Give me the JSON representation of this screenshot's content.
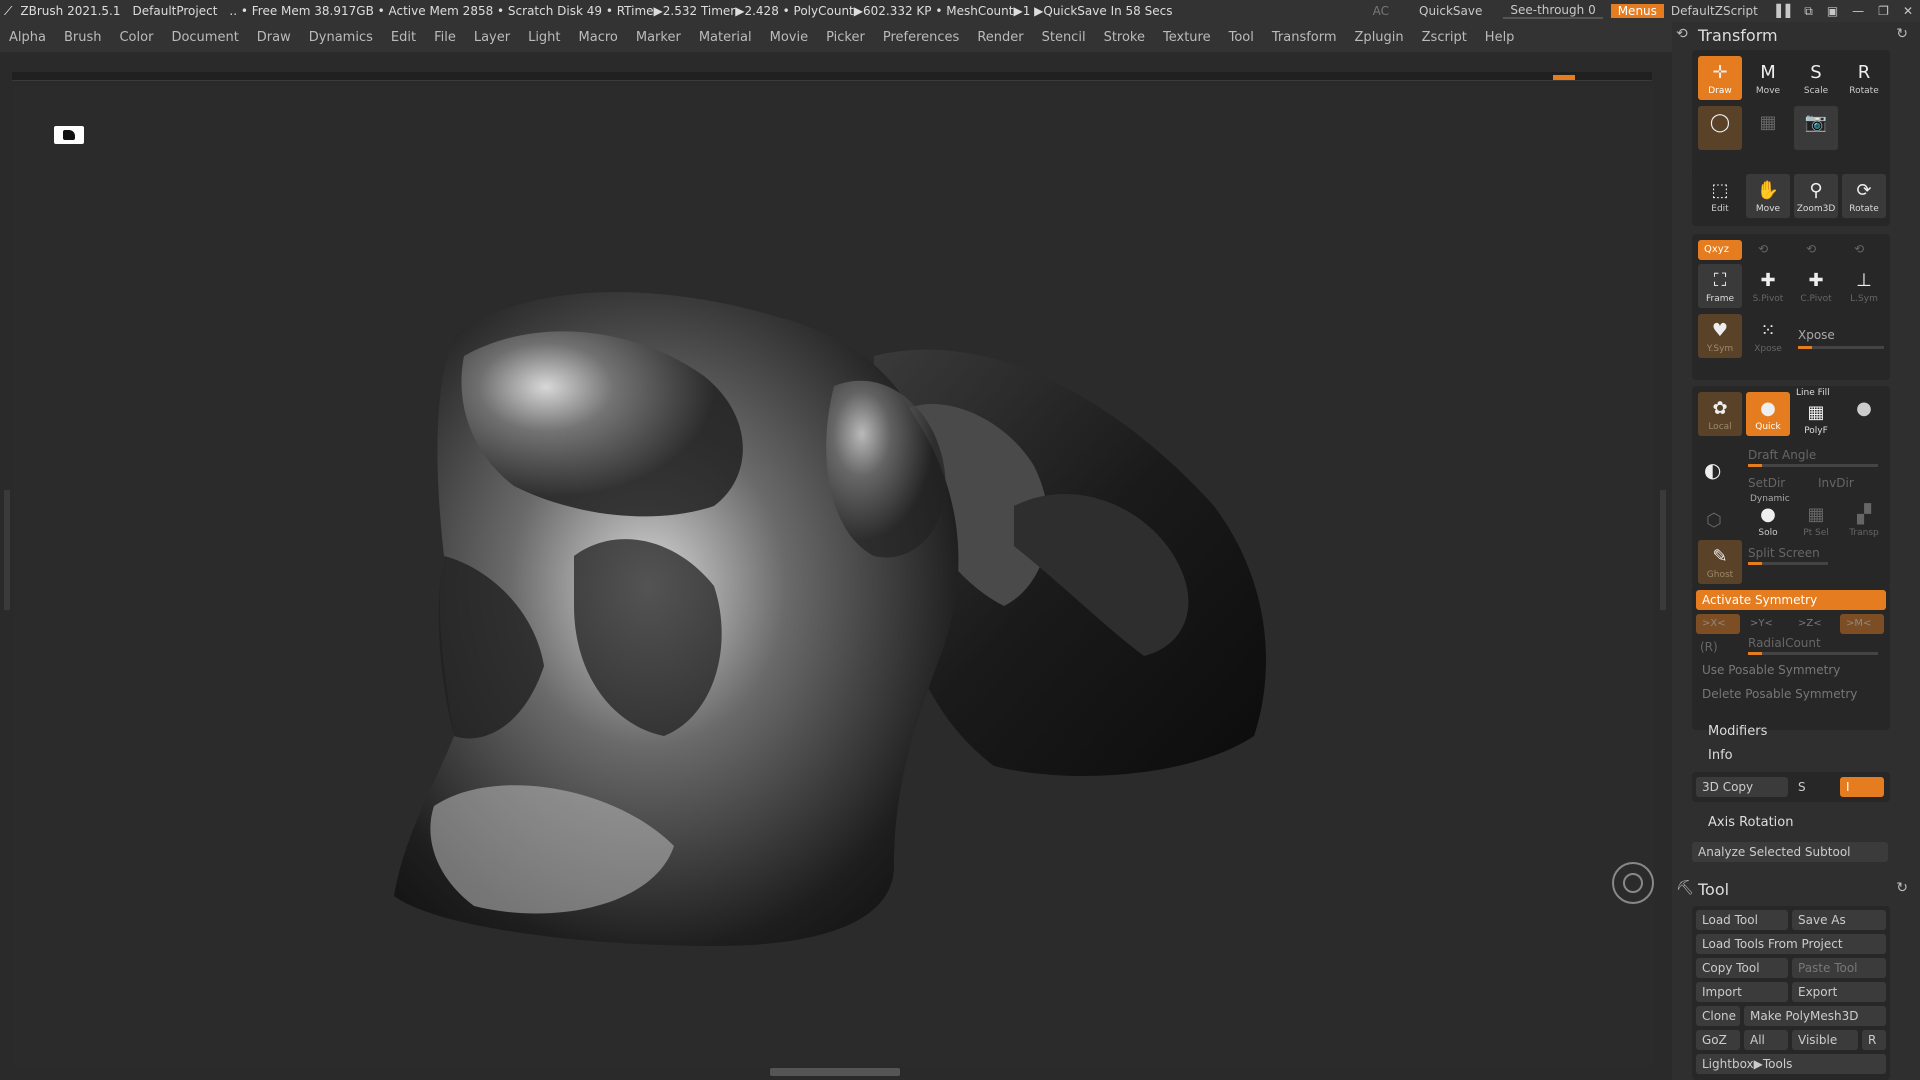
{
  "topbar": {
    "app": "ZBrush 2021.5.1",
    "project": "DefaultProject",
    "stats": ".. • Free Mem 38.917GB • Active Mem 2858 • Scratch Disk 49 •  RTime▶2.532 Timer▶2.428 • PolyCount▶602.332 KP  • MeshCount▶1  ▶QuickSave In 58 Secs",
    "ac": "AC",
    "quicksave": "QuickSave",
    "see_through": "See-through  0",
    "menus": "Menus",
    "script": "DefaultZScript"
  },
  "menus": [
    "Alpha",
    "Brush",
    "Color",
    "Document",
    "Draw",
    "Dynamics",
    "Edit",
    "File",
    "Layer",
    "Light",
    "Macro",
    "Marker",
    "Material",
    "Movie",
    "Picker",
    "Preferences",
    "Render",
    "Stencil",
    "Stroke",
    "Texture",
    "Tool",
    "Transform",
    "Zplugin",
    "Zscript",
    "Help"
  ],
  "transform": {
    "title": "Transform",
    "row1": [
      "Draw",
      "Move",
      "Scale",
      "Rotate"
    ],
    "row3": [
      "Edit",
      "Move",
      "Zoom3D",
      "Rotate"
    ],
    "xyz": "Qxyz",
    "frame": "Frame",
    "spivot": "S.Pivot",
    "cpivot": "C.Pivot",
    "lsym": "L.Sym",
    "ysym": "Y.Sym",
    "xpose_btn": "Xpose",
    "xpose": "Xpose",
    "local": "Local",
    "quick": "Quick",
    "line_fill": "Line Fill",
    "polyf": "PolyF",
    "draft_angle": "Draft Angle",
    "setdir": "SetDir",
    "invdir": "InvDir",
    "dynamic": "Dynamic",
    "solo": "Solo",
    "ptsel": "Pt Sel",
    "transp": "Transp",
    "ghost": "Ghost",
    "split_screen": "Split Screen",
    "activate_symmetry": "Activate Symmetry",
    "axes": [
      ">X<",
      ">Y<",
      ">Z<",
      ">M<"
    ],
    "r": "(R)",
    "radial_count": "RadialCount",
    "use_posable": "Use Posable Symmetry",
    "delete_posable": "Delete Posable Symmetry",
    "modifiers": "Modifiers",
    "info": "Info",
    "copy3d": "3D Copy",
    "s": "S",
    "i": "I",
    "axis_rotation": "Axis Rotation",
    "analyze": "Analyze Selected Subtool"
  },
  "tool": {
    "title": "Tool",
    "load_tool": "Load Tool",
    "save_as": "Save As",
    "load_from_project": "Load Tools From Project",
    "copy_tool": "Copy Tool",
    "paste_tool": "Paste Tool",
    "import": "Import",
    "export": "Export",
    "clone": "Clone",
    "make_polymesh": "Make PolyMesh3D",
    "goz": "GoZ",
    "all": "All",
    "visible": "Visible",
    "r": "R",
    "lightbox": "Lightbox▶Tools"
  }
}
